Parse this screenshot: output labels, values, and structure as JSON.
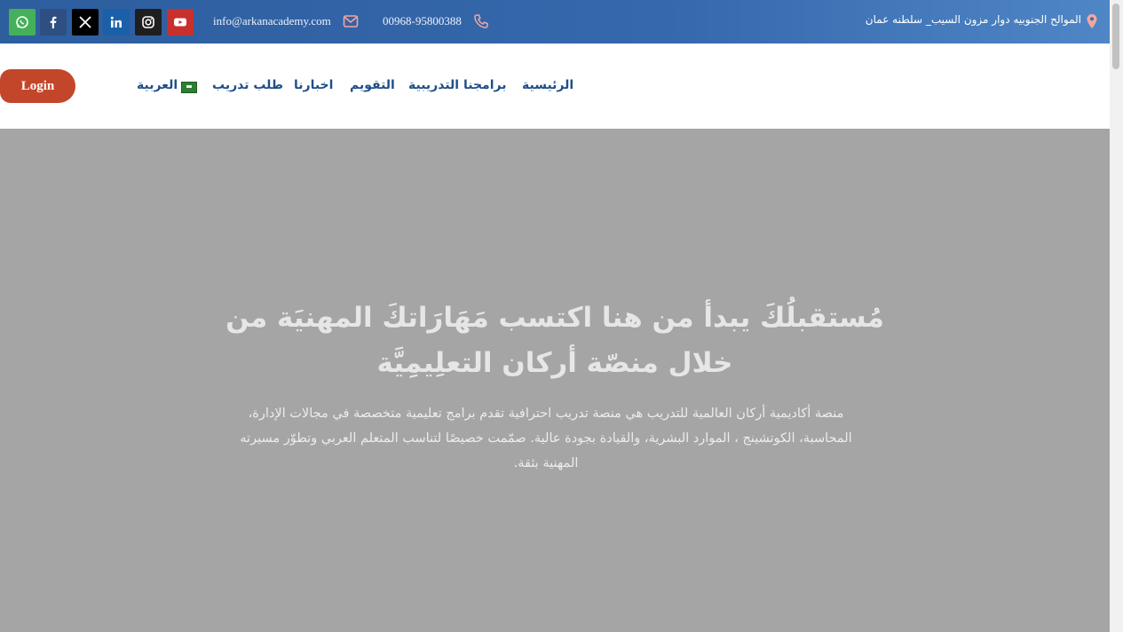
{
  "topbar": {
    "email": "info@arkanacademy.com",
    "phone": "00968-95800388",
    "address": "الموالح الجنوبيه دوار مزون السيب_ سلطنه عمان",
    "social": [
      "whatsapp-icon",
      "facebook-icon",
      "x-icon",
      "linkedin-icon",
      "instagram-icon",
      "youtube-icon"
    ]
  },
  "header": {
    "login_label": "Login",
    "nav": {
      "home": "الرئيسية",
      "programs": "برامجنا التدريبية",
      "calendar": "التقويم",
      "news": "اخبارنا",
      "request": "طلب تدريب",
      "language": "العربية"
    }
  },
  "hero": {
    "title": "مُستقبلُكَ يبدأ من هنا اكتسب مَهَارَاتكَ المهنيَة من خلال منصّة أركان التعلِيمِيَّة",
    "description": "منصة أكاديمية أركان العالمية للتدريب هي منصة تدريب احترافية تقدم برامج تعليمية متخصصة في مجالات الإدارة، المحاسبة، الكوتشينج ، الموارد البشرية، والقيادة بجودة عالية. صمّمت خصيصًا لتناسب المتعلم العربي وتطوّر مسيرته المهنية بثقة."
  },
  "colors": {
    "topbar": "#3568ad",
    "login": "#c4462a",
    "nav_text": "#1f4f8a",
    "hero_bg": "#a5a5a5"
  }
}
